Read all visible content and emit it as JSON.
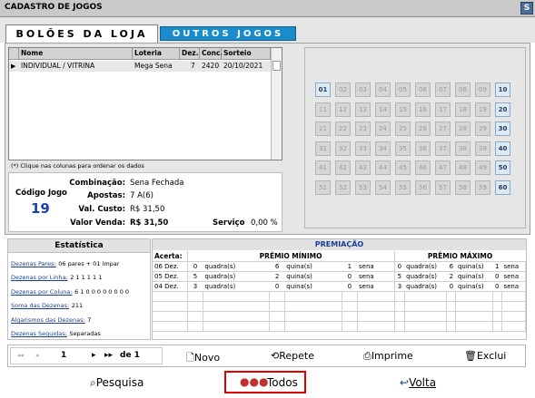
{
  "window": {
    "title": "CADASTRO DE JOGOS",
    "app_icon": "S"
  },
  "tabs": [
    {
      "label": "BOLÕES DA LOJA"
    },
    {
      "label": "OUTROS JOGOS"
    }
  ],
  "grid": {
    "columns": [
      "Nome",
      "Loteria",
      "Dez.",
      "Conc.",
      "Sorteio"
    ],
    "rows": [
      {
        "nome": "INDIVIDUAL / VITRINA",
        "loteria": "Mega Sena",
        "dez": "7",
        "conc": "2420",
        "sorteio": "20/10/2021"
      }
    ],
    "note": "(*) Clique nas colunas para ordenar os dados"
  },
  "info": {
    "codigo_label": "Código Jogo",
    "codigo_value": "19",
    "combinacao_label": "Combinação:",
    "combinacao_value": "Sena Fechada",
    "apostas_label": "Apostas:",
    "apostas_value": "7 A(6)",
    "val_custo_label": "Val. Custo:",
    "val_custo_value": "R$ 31,50",
    "valor_venda_label": "Valor Venda:",
    "valor_venda_value": "R$ 31,50",
    "servico_label": "Serviço",
    "servico_value": "0,00 %"
  },
  "numbers": {
    "values": [
      "01",
      "02",
      "03",
      "04",
      "05",
      "06",
      "07",
      "08",
      "09",
      "10",
      "11",
      "12",
      "13",
      "14",
      "15",
      "16",
      "17",
      "18",
      "19",
      "20",
      "21",
      "22",
      "23",
      "24",
      "25",
      "26",
      "27",
      "28",
      "29",
      "30",
      "31",
      "32",
      "33",
      "34",
      "35",
      "36",
      "37",
      "38",
      "39",
      "40",
      "41",
      "42",
      "43",
      "44",
      "45",
      "46",
      "47",
      "48",
      "49",
      "50",
      "51",
      "52",
      "53",
      "54",
      "55",
      "56",
      "57",
      "58",
      "59",
      "60"
    ],
    "highlighted": [
      "01",
      "10",
      "20",
      "30",
      "40",
      "50",
      "60"
    ]
  },
  "estatistica": {
    "title": "Estatística",
    "items": [
      {
        "label": "Dezenas Pares:",
        "value": "06 pares + 01 ímpar"
      },
      {
        "label": "Dezenas por Linha:",
        "value": "2 1 1 1 1 1"
      },
      {
        "label": "Dezenas por Coluna:",
        "value": "6 1 0 0 0 0 0 0 0 0"
      },
      {
        "label": "Soma das Dezenas:",
        "value": "211"
      },
      {
        "label": "Algarismos das Dezenas:",
        "value": "7"
      },
      {
        "label": "Dezenas Seguidas:",
        "value": "Separadas"
      }
    ]
  },
  "premiacao": {
    "title": "PREMIAÇÃO",
    "acerta_label": "Acerta:",
    "min_label": "PRÊMIO MÍNIMO",
    "max_label": "PRÊMIO MÁXIMO",
    "quadra": "quadra(s)",
    "quina": "quina(s)",
    "sena": "sena",
    "rows": [
      {
        "dez": "06 Dez.",
        "min": [
          "0",
          "6",
          "1"
        ],
        "max": [
          "0",
          "6",
          "1"
        ]
      },
      {
        "dez": "05 Dez.",
        "min": [
          "5",
          "2",
          "0"
        ],
        "max": [
          "5",
          "2",
          "0"
        ]
      },
      {
        "dez": "04 Dez.",
        "min": [
          "3",
          "0",
          "0"
        ],
        "max": [
          "3",
          "0",
          "0"
        ]
      }
    ]
  },
  "navigator": {
    "first": "◂◂",
    "prev": "◂",
    "page": "1",
    "next": "▸",
    "last": "▸▸",
    "of_label": "de 1"
  },
  "toolbar": {
    "novo": "Novo",
    "repete": "Repete",
    "imprime": "Imprime",
    "exclui": "Exclui"
  },
  "bottom": {
    "pesquisa": "Pesquisa",
    "todos": "Todos",
    "volta": "Volta"
  }
}
